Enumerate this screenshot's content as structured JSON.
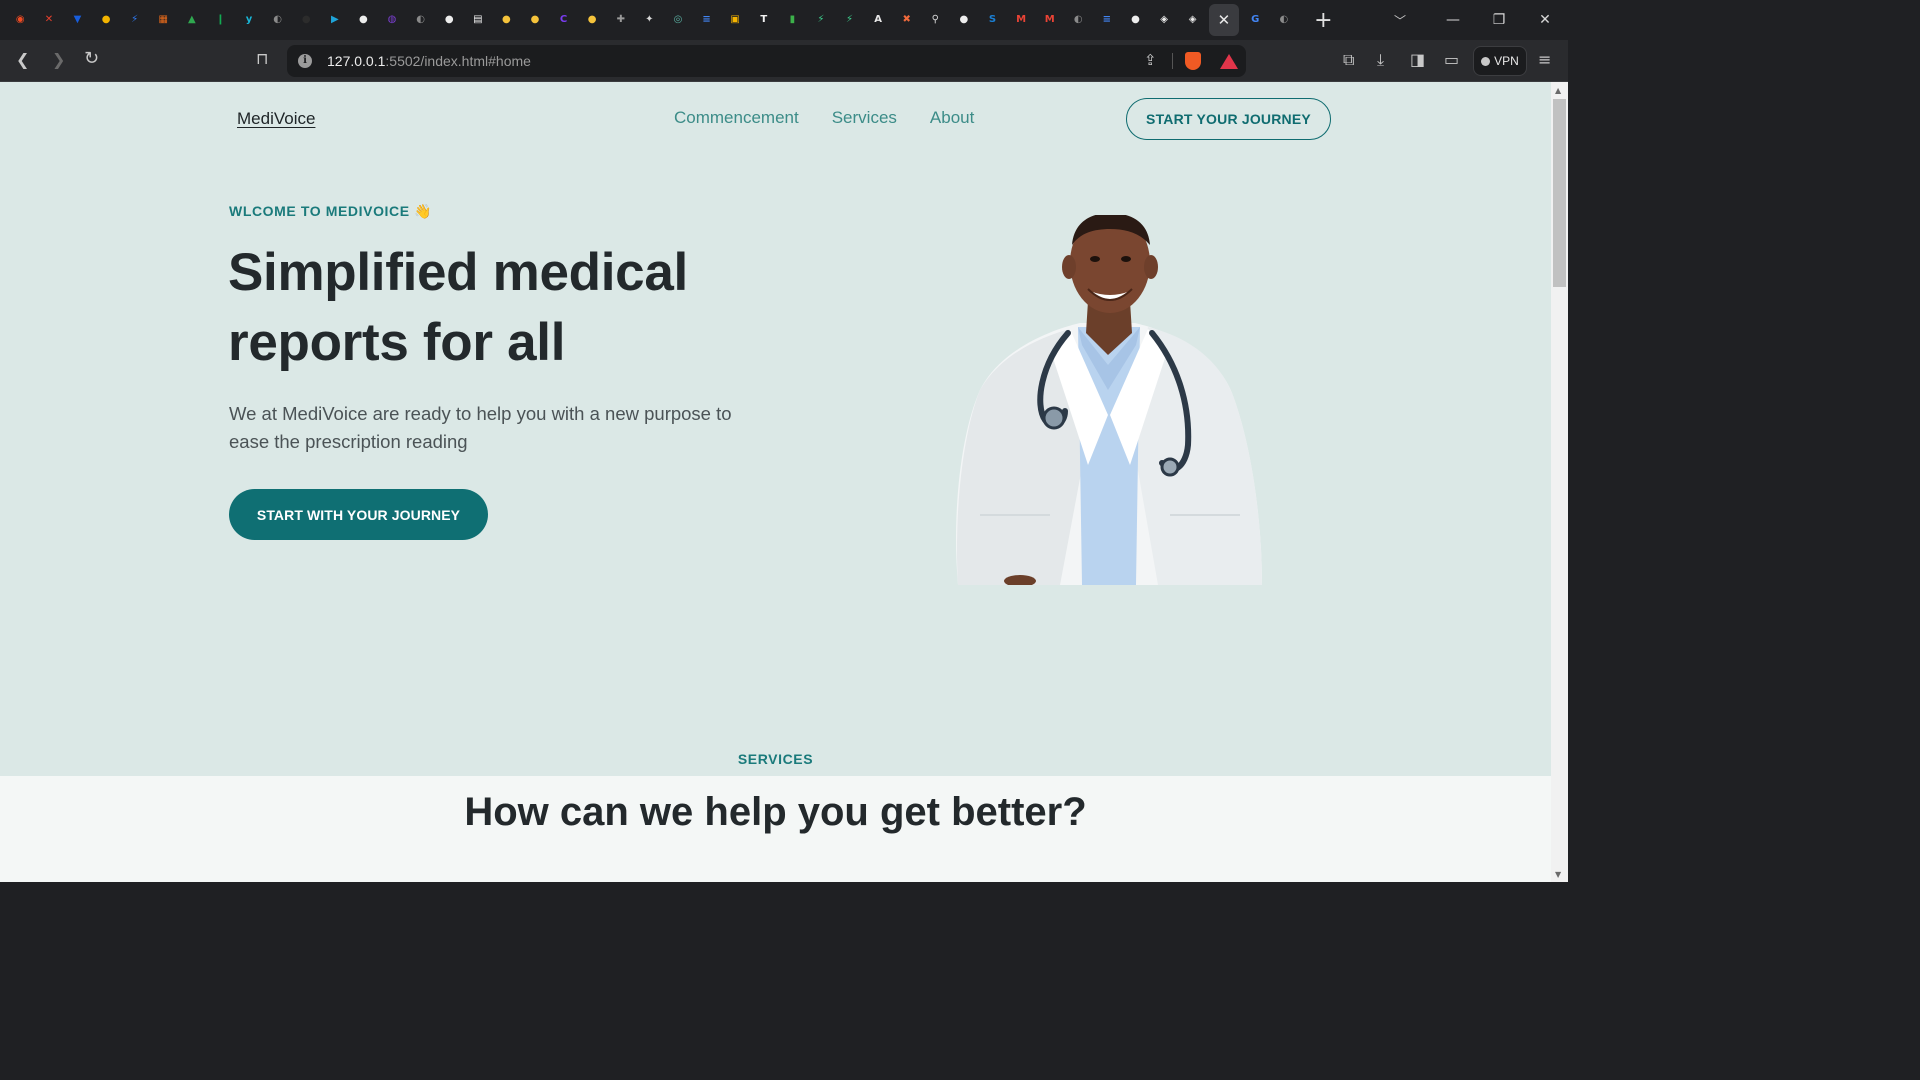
{
  "browser": {
    "favicons": [
      {
        "icon": "brave-tab-icon",
        "color": "#f04b23",
        "glyph": "◉"
      },
      {
        "icon": "arrow-tab-icon",
        "color": "#e8402d",
        "glyph": "✕"
      },
      {
        "icon": "bitwarden-tab-icon",
        "color": "#175ddc",
        "glyph": "▼"
      },
      {
        "icon": "chrome-tab-icon",
        "color": "#f3b400",
        "glyph": "●"
      },
      {
        "icon": "bolt-tab-icon",
        "color": "#2f7bf5",
        "glyph": "⚡"
      },
      {
        "icon": "brick-tab-icon",
        "color": "#e86a1a",
        "glyph": "▦"
      },
      {
        "icon": "drive-tab-icon",
        "color": "#2fa84f",
        "glyph": "▲"
      },
      {
        "icon": "leaf-tab-icon",
        "color": "#13aa52",
        "glyph": "❙"
      },
      {
        "icon": "y-tab-icon",
        "color": "#19b5d6",
        "glyph": "y"
      },
      {
        "icon": "globe-tab-icon",
        "color": "#8a8a8a",
        "glyph": "◐"
      },
      {
        "icon": "dark-tab-icon",
        "color": "#2c2c2c",
        "glyph": "●"
      },
      {
        "icon": "play-tab-icon",
        "color": "#1fa4d9",
        "glyph": "▶"
      },
      {
        "icon": "github-tab-icon",
        "color": "#ededed",
        "glyph": "●"
      },
      {
        "icon": "onenote-tab-icon",
        "color": "#7b3fd1",
        "glyph": "◍"
      },
      {
        "icon": "globe-tab-icon",
        "color": "#8a8a8a",
        "glyph": "◐"
      },
      {
        "icon": "github-tab-icon",
        "color": "#ededed",
        "glyph": "●"
      },
      {
        "icon": "page-tab-icon",
        "color": "#f2f2f2",
        "glyph": "▤"
      },
      {
        "icon": "ghost-tab-icon",
        "color": "#f5c33b",
        "glyph": "●"
      },
      {
        "icon": "ghost-tab-icon",
        "color": "#f5c33b",
        "glyph": "●"
      },
      {
        "icon": "c-tab-icon",
        "color": "#7a3cf0",
        "glyph": "C"
      },
      {
        "icon": "ghost-tab-icon",
        "color": "#f5c33b",
        "glyph": "●"
      },
      {
        "icon": "plus-tile-tab-icon",
        "color": "#9a9a9a",
        "glyph": "✚"
      },
      {
        "icon": "sparkle-tab-icon",
        "color": "#d8d8d8",
        "glyph": "✦"
      },
      {
        "icon": "openai-tab-icon",
        "color": "#5cb3a5",
        "glyph": "◎"
      },
      {
        "icon": "docs-tab-icon",
        "color": "#4285f4",
        "glyph": "≡"
      },
      {
        "icon": "slides-tab-icon",
        "color": "#f5b400",
        "glyph": "▣"
      },
      {
        "icon": "tv-tab-icon",
        "color": "#f2f2f2",
        "glyph": "T"
      },
      {
        "icon": "bar-chart-tab-icon",
        "color": "#3cb14a",
        "glyph": "▮"
      },
      {
        "icon": "supabase-tab-icon",
        "color": "#3ecf8e",
        "glyph": "⚡"
      },
      {
        "icon": "supabase-tab-icon",
        "color": "#3ecf8e",
        "glyph": "⚡"
      },
      {
        "icon": "a-tab-icon",
        "color": "#e8e8e8",
        "glyph": "A"
      },
      {
        "icon": "tools-tab-icon",
        "color": "#f06a3c",
        "glyph": "✖"
      },
      {
        "icon": "zoom-tab-icon",
        "color": "#d8d8d8",
        "glyph": "⚲"
      },
      {
        "icon": "github-tab-icon",
        "color": "#ededed",
        "glyph": "●"
      },
      {
        "icon": "sap-tab-icon",
        "color": "#1a7fd4",
        "glyph": "S"
      },
      {
        "icon": "gmail-tab-icon",
        "color": "#ea4335",
        "glyph": "M"
      },
      {
        "icon": "gmail-tab-icon",
        "color": "#ea4335",
        "glyph": "M"
      },
      {
        "icon": "globe-tab-icon",
        "color": "#8a8a8a",
        "glyph": "◐"
      },
      {
        "icon": "docs-tab-icon",
        "color": "#4285f4",
        "glyph": "≡"
      },
      {
        "icon": "github-tab-icon",
        "color": "#ededed",
        "glyph": "●"
      },
      {
        "icon": "codepen-tab-icon",
        "color": "#ededed",
        "glyph": "◈"
      },
      {
        "icon": "codepen-tab-icon",
        "color": "#ededed",
        "glyph": "◈"
      }
    ],
    "active_tab_close": "✕",
    "trailing_favicons": [
      {
        "icon": "google-tab-icon",
        "color": "#4285f4",
        "glyph": "G"
      },
      {
        "icon": "globe-tab-icon",
        "color": "#8a8a8a",
        "glyph": "◐"
      }
    ],
    "new_tab": "+",
    "url_host": "127.0.0.1",
    "url_rest": ":5502/index.html#home",
    "vpn_label": "VPN"
  },
  "page": {
    "logo": "MediVoice",
    "nav": [
      "Commencement",
      "Services",
      "About"
    ],
    "cta_top": "START YOUR JOURNEY",
    "hero": {
      "eyebrow": "WLCOME TO MEDIVOICE",
      "eyebrow_emoji": "👋",
      "title": "Simplified medical reports for all",
      "subtitle": "We at MediVoice are ready to help you with a new purpose to ease the prescription reading",
      "cta": "START WITH YOUR JOURNEY"
    },
    "services": {
      "eyebrow": "SERVICES",
      "title": "How can we help you get better?"
    }
  },
  "colors": {
    "page_bg": "#dbe8e6",
    "brand_teal": "#0f6f73",
    "nav_text": "#3c8c88",
    "heading": "#23292c"
  }
}
